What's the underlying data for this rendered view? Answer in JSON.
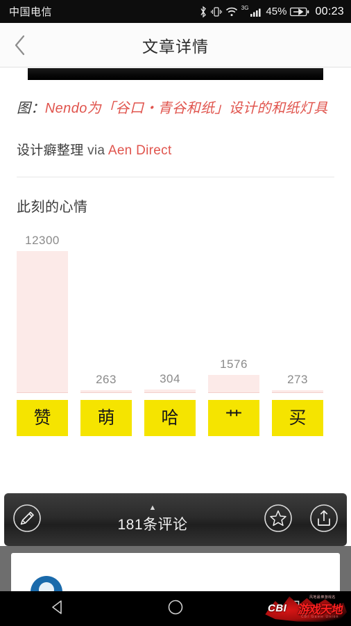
{
  "status_bar": {
    "carrier": "中国电信",
    "network": "3G",
    "battery_percent": "45%",
    "clock": "00:23",
    "icons": [
      "bluetooth-icon",
      "vibrate-icon",
      "wifi-icon",
      "signal-icon",
      "battery-charging-icon"
    ]
  },
  "title_bar": {
    "back_icon": "chevron-left-icon",
    "title": "文章详情"
  },
  "article": {
    "caption_lead": "图：",
    "caption": "Nendo为「谷口・青谷和纸」设计的和纸灯具",
    "byline_prefix": "设计癖整理",
    "byline_via": "via",
    "byline_source": "Aen Direct",
    "colors": {
      "link": "#e0544d",
      "text": "#3a3a3a"
    }
  },
  "mood": {
    "heading": "此刻的心情"
  },
  "chart_data": {
    "type": "bar",
    "title": "此刻的心情",
    "categories": [
      "赞",
      "萌",
      "哈",
      "艹",
      "买"
    ],
    "values": [
      12300,
      263,
      304,
      1576,
      273
    ],
    "value_labels": [
      "12300",
      "263",
      "304",
      "1576",
      "273"
    ],
    "xlabel": "",
    "ylabel": "",
    "ylim": [
      0,
      12300
    ],
    "grid": false,
    "legend": false,
    "bar_color": "#fceae8",
    "label_color": "#8a8a8a"
  },
  "reactions": {
    "buttons": [
      {
        "label": "赞",
        "count": "12300"
      },
      {
        "label": "萌",
        "count": "263"
      },
      {
        "label": "哈",
        "count": "304"
      },
      {
        "label": "艹",
        "count": "1576"
      },
      {
        "label": "买",
        "count": "273"
      }
    ],
    "button_color": "#f5e400"
  },
  "action_bar": {
    "compose_icon": "pencil-circle-icon",
    "caret_icon": "caret-up-icon",
    "comment_count": "181条评论",
    "favorite_icon": "star-circle-icon",
    "share_icon": "share-circle-icon"
  },
  "nav_bar": {
    "back_icon": "triangle-back-icon",
    "home_icon": "circle-home-icon",
    "recents_icon": "square-recents-icon"
  },
  "watermark": {
    "brand": "CBI",
    "name": "游戏天地",
    "top_text": "风地最棒游戏名",
    "bottom_text": "CBI Game Union"
  }
}
